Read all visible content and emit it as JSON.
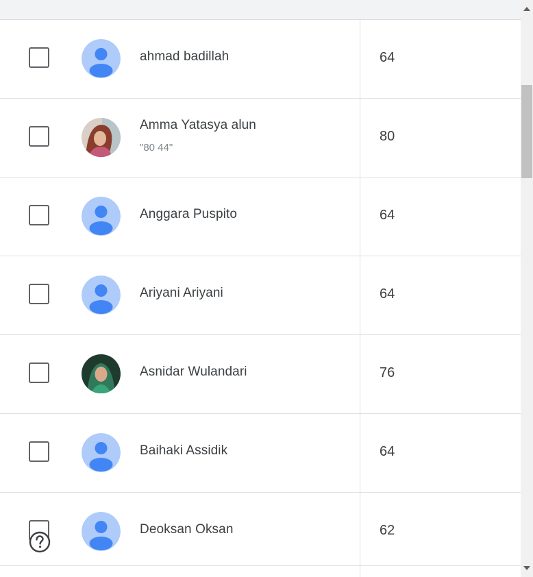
{
  "students": [
    {
      "name": "ahmad badillah",
      "sub": "",
      "grade": "64",
      "avatar": "default-avatar"
    },
    {
      "name": "Amma Yatasya alun",
      "sub": "\"80 44\"",
      "grade": "80",
      "avatar": "photo-avatar"
    },
    {
      "name": "Anggara Puspito",
      "sub": "",
      "grade": "64",
      "avatar": "default-avatar"
    },
    {
      "name": "Ariyani Ariyani",
      "sub": "",
      "grade": "64",
      "avatar": "default-avatar"
    },
    {
      "name": "Asnidar Wulandari",
      "sub": "",
      "grade": "76",
      "avatar": "photo-avatar"
    },
    {
      "name": "Baihaki Assidik",
      "sub": "",
      "grade": "64",
      "avatar": "default-avatar"
    },
    {
      "name": "Deoksan Oksan",
      "sub": "",
      "grade": "62",
      "avatar": "default-avatar"
    }
  ],
  "colors": {
    "default_avatar_bg": "#aecbfa",
    "default_avatar_fg": "#4285f4",
    "text": "#3c4043"
  },
  "icons": {
    "checkbox": "checkbox-icon",
    "help": "help-circle-icon",
    "scroll_up": "arrow-up-icon",
    "scroll_down": "arrow-down-icon"
  }
}
